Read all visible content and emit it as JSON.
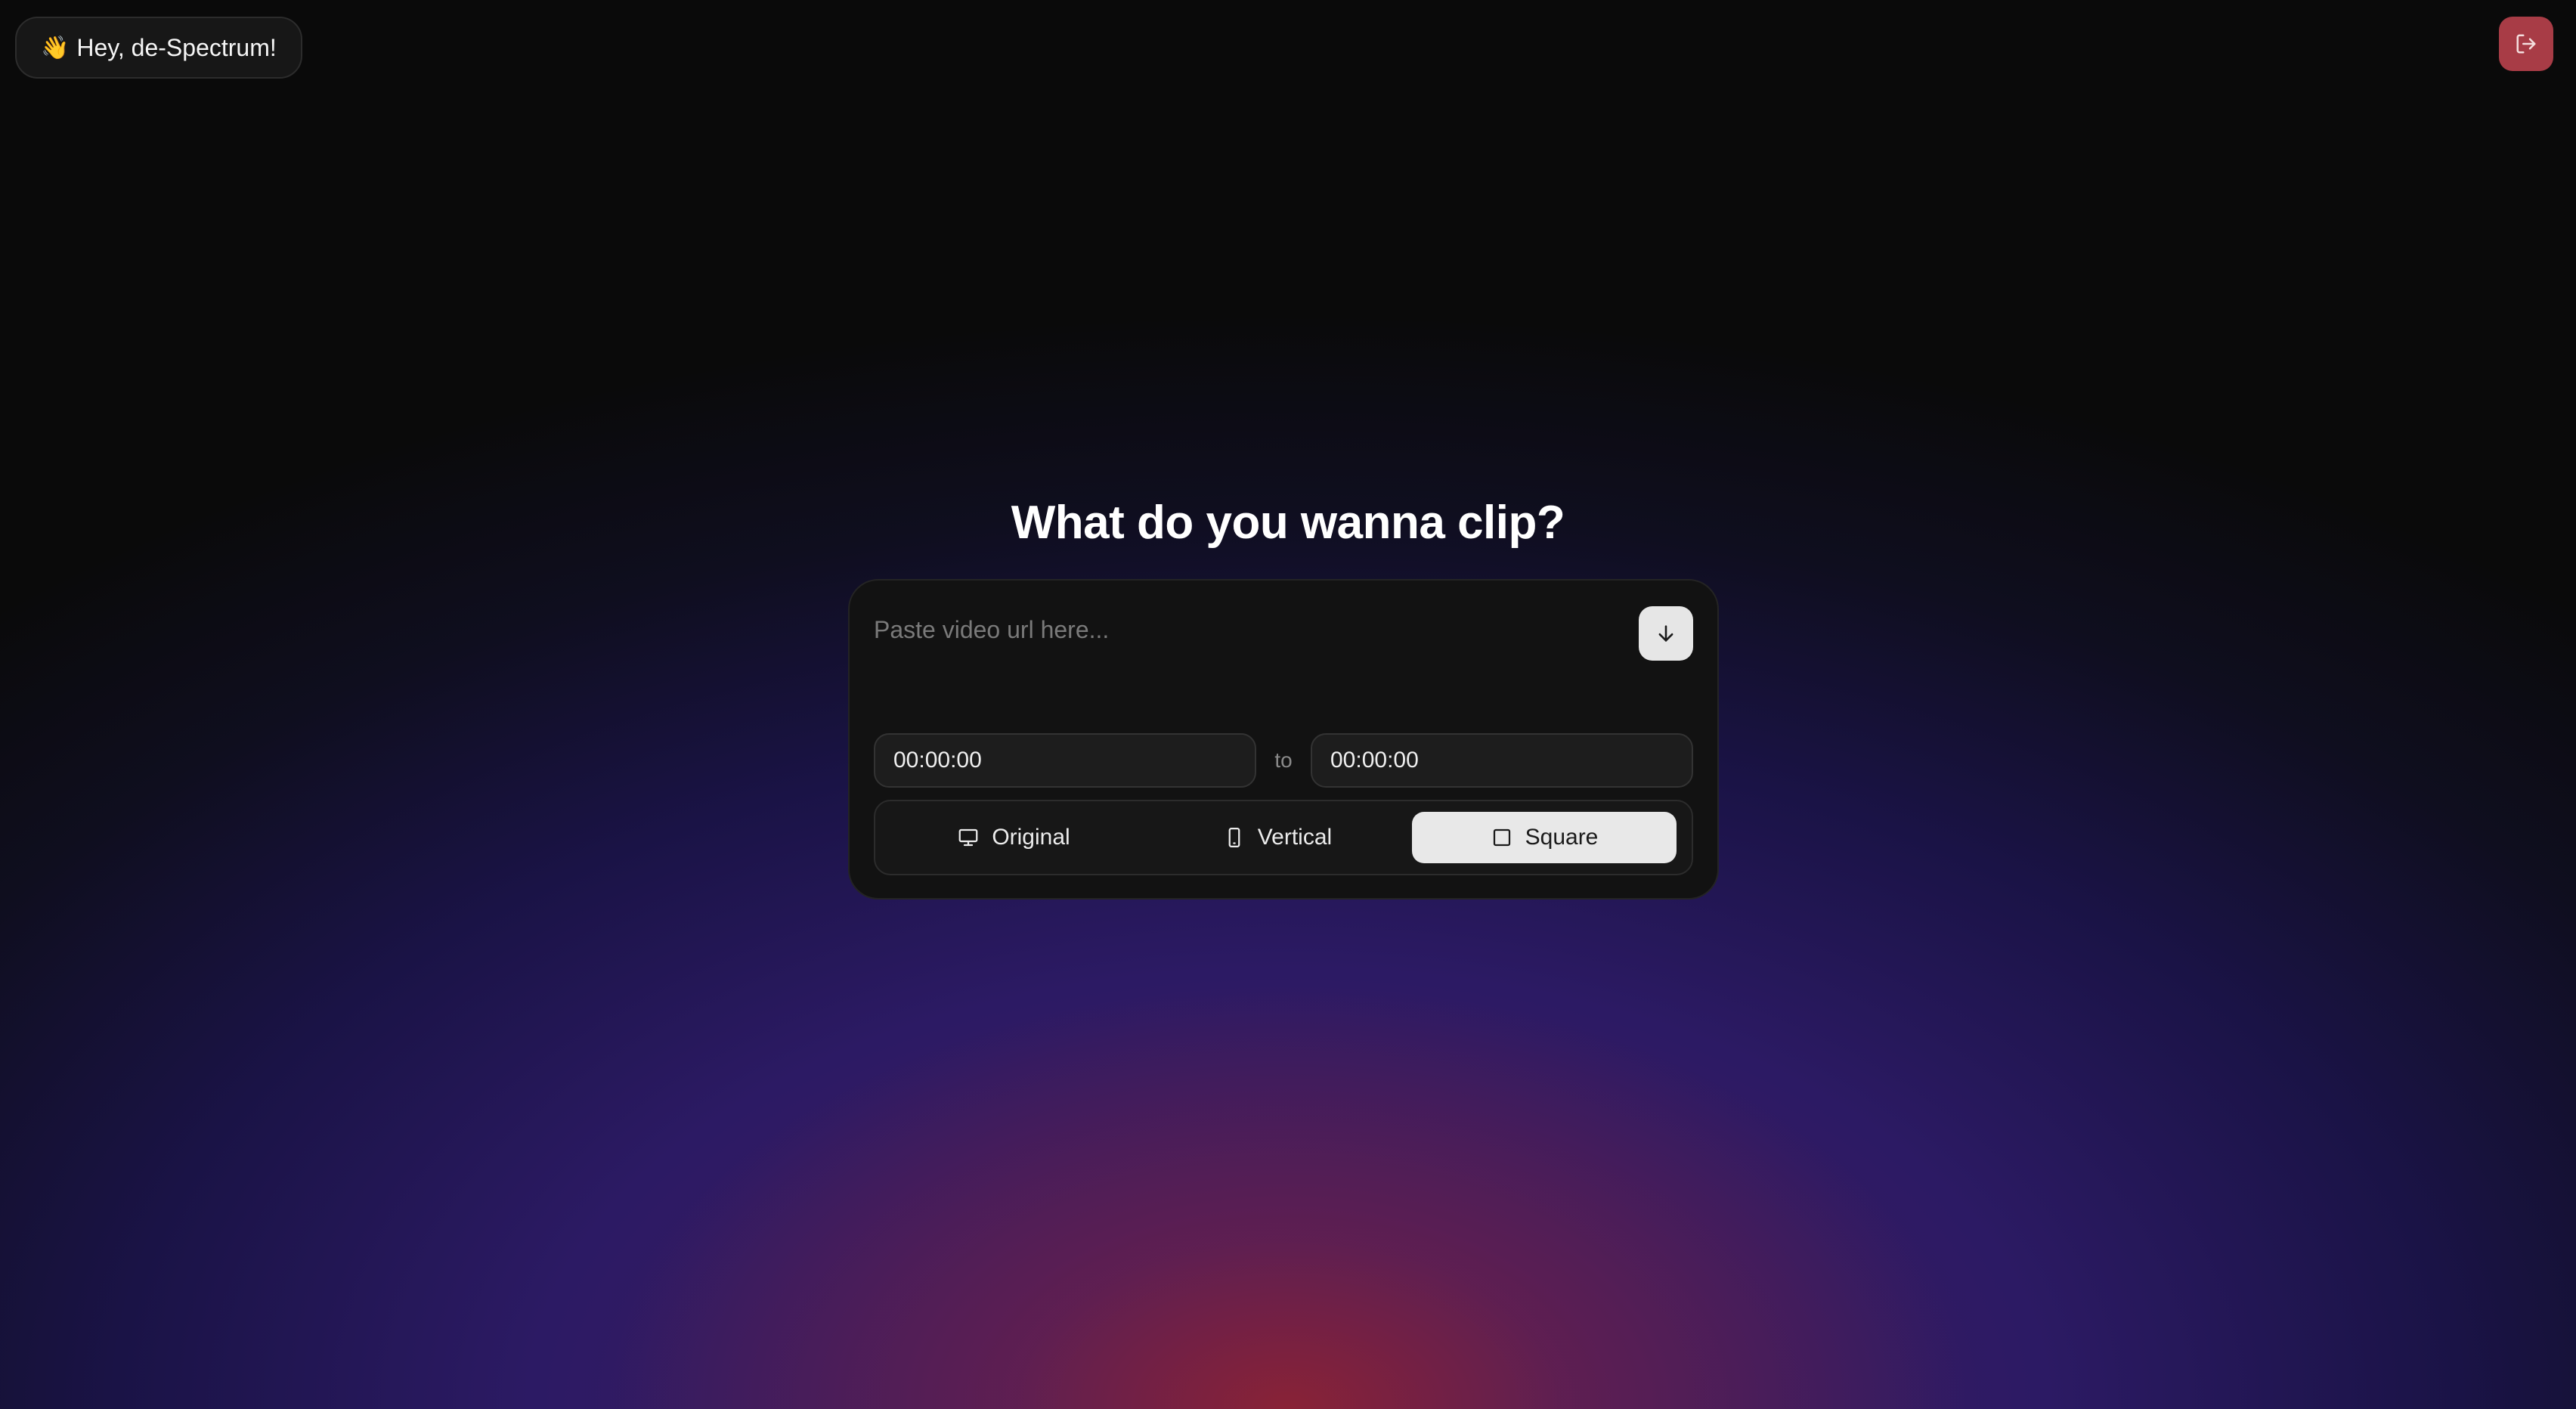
{
  "header": {
    "greeting_emoji": "👋",
    "greeting_text": "Hey, de-Spectrum!",
    "logout_icon": "logout-icon",
    "logout_color": "#a83c46"
  },
  "main": {
    "title": "What do you wanna clip?",
    "url_input": {
      "placeholder": "Paste video url here...",
      "value": ""
    },
    "submit_icon": "arrow-down-icon",
    "time_range": {
      "start": "00:00:00",
      "separator": "to",
      "end": "00:00:00"
    },
    "formats": [
      {
        "label": "Original",
        "icon": "monitor-icon",
        "selected": false
      },
      {
        "label": "Vertical",
        "icon": "phone-icon",
        "selected": false
      },
      {
        "label": "Square",
        "icon": "square-icon",
        "selected": true
      }
    ]
  },
  "theme": {
    "background": "#0a0a0a",
    "card": "#121212",
    "accent_selected": "#e8e8e8",
    "glow_red": "#8c2234",
    "glow_purple": "#2c1a64"
  }
}
